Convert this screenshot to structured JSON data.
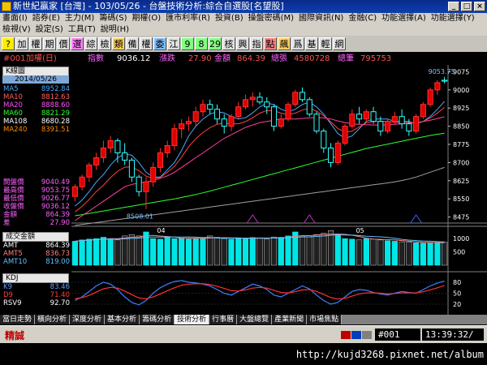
{
  "window": {
    "title": "新世紀贏家 [台灣] - 103/05/26 - 台盤技術分析:綜合自選股[名望股]",
    "icon": "app-logo-icon"
  },
  "menu1": [
    "畫面(I)",
    "諮券(E)",
    "主力(M)",
    "籌碼(S)",
    "期權(O)",
    "匯市利率(R)",
    "投資(B)",
    "操盤密碼(M)",
    "國際資訊(N)",
    "金融(C)",
    "功能選擇(A)",
    "功能選擇(Y)"
  ],
  "menu2": [
    "檢視(V)",
    "設定(S)",
    "工具(T)",
    "說明(H)"
  ],
  "toolbar": [
    "?",
    "加",
    "權",
    "期",
    "價",
    "選",
    "綜",
    "檢",
    "類",
    "備",
    "權",
    "委",
    "江",
    "9",
    "8",
    "29",
    "核",
    "興",
    "指",
    "點",
    "飆",
    "爲",
    "基",
    "輕",
    "網"
  ],
  "info": {
    "code": "#001",
    "name": "加權(日)",
    "index_label": "指數",
    "index_value": "9036.12",
    "change_label": "漲跌",
    "change_value": "27.90",
    "amount_label": "金額",
    "amount_value": "864.39",
    "vol_label": "總張",
    "vol_value": "4580728",
    "count_label": "總筆",
    "count_value": "795753"
  },
  "kline_panel": {
    "header": "K線圖",
    "date": "2014/05/26",
    "ma": [
      {
        "name": "MA5",
        "value": "8952.84",
        "color": "#4aa8ff"
      },
      {
        "name": "MA10",
        "value": "8812.63",
        "color": "#ff6060"
      },
      {
        "name": "MA20",
        "value": "8888.60",
        "color": "#ff50ff"
      },
      {
        "name": "MA60",
        "value": "8821.29",
        "color": "#30ff30"
      },
      {
        "name": "MA108",
        "value": "8680.28",
        "color": "#ffffff"
      },
      {
        "name": "MA240",
        "value": "8391.51",
        "color": "#ff8c00"
      }
    ],
    "ohlc": [
      {
        "name": "開盤價",
        "value": "9040.49"
      },
      {
        "name": "最高價",
        "value": "9053.75"
      },
      {
        "name": "最低價",
        "value": "9026.77"
      },
      {
        "name": "收盤價",
        "value": "9036.12"
      },
      {
        "name": "金額",
        "value": "864.39"
      },
      {
        "name": "差",
        "value": "27.90"
      }
    ]
  },
  "volume_panel": {
    "header": "成交金額",
    "rows": [
      {
        "name": "AMT",
        "value": "864.39"
      },
      {
        "name": "AMT5",
        "value": "836.73"
      },
      {
        "name": "AMT10",
        "value": "819.00"
      }
    ]
  },
  "kdj_panel": {
    "header": "KDJ",
    "rows": [
      {
        "name": "K9",
        "value": "83.46"
      },
      {
        "name": "D9",
        "value": "71.40"
      },
      {
        "name": "RSV9",
        "value": "92.70"
      }
    ]
  },
  "axis": {
    "price_ticks": [
      "9075",
      "9000",
      "8925",
      "8850",
      "8775",
      "8700",
      "8625",
      "8550",
      "8475"
    ],
    "vol_ticks": [
      "1000",
      "500"
    ],
    "kd_ticks": [
      "80",
      "50",
      "20"
    ],
    "months": [
      "04",
      "05"
    ],
    "high_label": "9053.75",
    "low_label": "8508.01"
  },
  "chart_data": {
    "type": "candlestick",
    "candles": [
      [
        8560,
        8610,
        8540,
        8600
      ],
      [
        8600,
        8650,
        8585,
        8640
      ],
      [
        8640,
        8700,
        8620,
        8690
      ],
      [
        8690,
        8740,
        8670,
        8720
      ],
      [
        8720,
        8790,
        8700,
        8760
      ],
      [
        8760,
        8810,
        8740,
        8790
      ],
      [
        8790,
        8800,
        8700,
        8740
      ],
      [
        8740,
        8780,
        8690,
        8710
      ],
      [
        8710,
        8720,
        8620,
        8640
      ],
      [
        8640,
        8650,
        8560,
        8580
      ],
      [
        8580,
        8640,
        8508,
        8620
      ],
      [
        8620,
        8700,
        8600,
        8680
      ],
      [
        8680,
        8760,
        8660,
        8740
      ],
      [
        8740,
        8790,
        8720,
        8770
      ],
      [
        8770,
        8860,
        8750,
        8840
      ],
      [
        8840,
        8880,
        8800,
        8860
      ],
      [
        8860,
        8890,
        8830,
        8870
      ],
      [
        8870,
        8930,
        8850,
        8910
      ],
      [
        8910,
        8960,
        8890,
        8940
      ],
      [
        8940,
        8960,
        8900,
        8920
      ],
      [
        8920,
        8940,
        8860,
        8880
      ],
      [
        8880,
        8900,
        8820,
        8850
      ],
      [
        8850,
        8900,
        8830,
        8890
      ],
      [
        8890,
        8950,
        8880,
        8930
      ],
      [
        8930,
        8980,
        8920,
        8960
      ],
      [
        8960,
        8990,
        8930,
        8970
      ],
      [
        8970,
        8990,
        8940,
        8950
      ],
      [
        8950,
        8970,
        8900,
        8930
      ],
      [
        8930,
        8940,
        8830,
        8850
      ],
      [
        8850,
        8900,
        8840,
        8880
      ],
      [
        8880,
        8950,
        8870,
        8940
      ],
      [
        8940,
        9000,
        8930,
        8990
      ],
      [
        8990,
        9010,
        8950,
        8960
      ],
      [
        8960,
        8970,
        8890,
        8900
      ],
      [
        8900,
        8910,
        8820,
        8830
      ],
      [
        8830,
        8840,
        8740,
        8760
      ],
      [
        8760,
        8780,
        8680,
        8700
      ],
      [
        8700,
        8790,
        8690,
        8780
      ],
      [
        8780,
        8860,
        8770,
        8850
      ],
      [
        8850,
        8920,
        8840,
        8900
      ],
      [
        8900,
        8930,
        8860,
        8880
      ],
      [
        8880,
        8920,
        8870,
        8910
      ],
      [
        8910,
        8930,
        8860,
        8870
      ],
      [
        8870,
        8890,
        8810,
        8830
      ],
      [
        8830,
        8880,
        8820,
        8870
      ],
      [
        8870,
        8910,
        8860,
        8890
      ],
      [
        8890,
        8920,
        8840,
        8860
      ],
      [
        8860,
        8880,
        8810,
        8830
      ],
      [
        8830,
        8900,
        8820,
        8890
      ],
      [
        8890,
        8950,
        8880,
        8940
      ],
      [
        8940,
        9010,
        8930,
        9000
      ],
      [
        9000,
        9040,
        8980,
        9030
      ],
      [
        9040,
        9054,
        9027,
        9036
      ]
    ],
    "ma5": [
      8520,
      8545,
      8580,
      8620,
      8650,
      8690,
      8720,
      8735,
      8730,
      8700,
      8660,
      8640,
      8640,
      8670,
      8700,
      8750,
      8810,
      8850,
      8880,
      8900,
      8910,
      8905,
      8890,
      8880,
      8885,
      8905,
      8930,
      8945,
      8940,
      8920,
      8910,
      8920,
      8940,
      8950,
      8930,
      8900,
      8860,
      8820,
      8800,
      8810,
      8840,
      8870,
      8880,
      8880,
      8880,
      8870,
      8870,
      8870,
      8860,
      8870,
      8890,
      8920,
      8953
    ],
    "ma20": [
      8460,
      8480,
      8500,
      8520,
      8540,
      8560,
      8580,
      8600,
      8610,
      8615,
      8620,
      8625,
      8635,
      8645,
      8660,
      8680,
      8700,
      8720,
      8740,
      8760,
      8780,
      8800,
      8815,
      8830,
      8845,
      8855,
      8865,
      8870,
      8875,
      8880,
      8880,
      8880,
      8882,
      8885,
      8886,
      8885,
      8880,
      8872,
      8865,
      8860,
      8858,
      8856,
      8855,
      8855,
      8856,
      8858,
      8860,
      8862,
      8865,
      8870,
      8875,
      8882,
      8889
    ],
    "ma60": [
      8480,
      8485,
      8490,
      8495,
      8500,
      8505,
      8510,
      8515,
      8520,
      8525,
      8530,
      8535,
      8540,
      8545,
      8550,
      8556,
      8562,
      8568,
      8575,
      8582,
      8590,
      8598,
      8606,
      8614,
      8622,
      8630,
      8638,
      8646,
      8654,
      8662,
      8670,
      8678,
      8686,
      8694,
      8702,
      8710,
      8718,
      8726,
      8734,
      8742,
      8750,
      8758,
      8764,
      8770,
      8776,
      8782,
      8788,
      8794,
      8800,
      8806,
      8812,
      8817,
      8821
    ],
    "ma108": [
      8440,
      8444,
      8448,
      8452,
      8456,
      8460,
      8464,
      8468,
      8472,
      8476,
      8480,
      8484,
      8488,
      8492,
      8496,
      8500,
      8504,
      8508,
      8512,
      8516,
      8520,
      8524,
      8528,
      8532,
      8536,
      8540,
      8544,
      8548,
      8552,
      8556,
      8560,
      8564,
      8568,
      8572,
      8576,
      8580,
      8584,
      8588,
      8592,
      8596,
      8600,
      8604,
      8608,
      8612,
      8616,
      8620,
      8626,
      8632,
      8640,
      8650,
      8660,
      8670,
      8680
    ],
    "volume": [
      900,
      950,
      980,
      1000,
      1050,
      1000,
      950,
      1100,
      1150,
      1100,
      1250,
      1000,
      980,
      1050,
      1000,
      1020,
      980,
      1000,
      1020,
      1100,
      1050,
      1000,
      980,
      1000,
      1020,
      1040,
      1010,
      980,
      1060,
      1050,
      1100,
      1250,
      1100,
      1060,
      1150,
      1200,
      1300,
      1150,
      1000,
      980,
      950,
      1000,
      980,
      950,
      920,
      900,
      880,
      860,
      840,
      830,
      850,
      860,
      864
    ],
    "k": [
      30,
      40,
      55,
      70,
      80,
      75,
      60,
      40,
      25,
      18,
      30,
      50,
      65,
      75,
      82,
      85,
      80,
      78,
      75,
      70,
      60,
      50,
      45,
      55,
      65,
      75,
      70,
      60,
      45,
      40,
      50,
      60,
      70,
      62,
      45,
      30,
      20,
      25,
      40,
      55,
      60,
      58,
      52,
      48,
      45,
      50,
      55,
      52,
      50,
      60,
      70,
      78,
      83
    ],
    "d": [
      35,
      38,
      44,
      53,
      62,
      66,
      64,
      56,
      46,
      37,
      35,
      40,
      48,
      57,
      65,
      72,
      75,
      76,
      76,
      74,
      69,
      63,
      57,
      56,
      59,
      64,
      66,
      64,
      58,
      52,
      51,
      54,
      59,
      60,
      55,
      47,
      38,
      34,
      36,
      42,
      48,
      51,
      51,
      50,
      48,
      49,
      51,
      51,
      51,
      54,
      59,
      65,
      71
    ]
  }
}
